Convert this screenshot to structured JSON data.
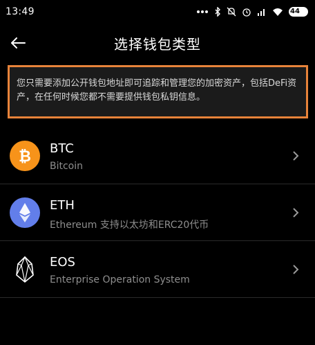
{
  "status_bar": {
    "time": "13:49",
    "battery": "44",
    "icons": [
      "dots-icon",
      "bluetooth-icon",
      "mute-icon",
      "alarm-icon",
      "signal-icon",
      "wifi-icon",
      "battery-icon"
    ]
  },
  "header": {
    "title": "选择钱包类型",
    "back_icon": "arrow-left-icon"
  },
  "notice": {
    "text": "您只需要添加公开钱包地址即可追踪和管理您的加密资产，包括DeFi资产，在任何时候您都不需要提供钱包私钥信息。",
    "highlight_color": "#e8833a"
  },
  "wallets": [
    {
      "symbol": "BTC",
      "name": "Bitcoin",
      "icon": "bitcoin-icon",
      "color": "#f7931a"
    },
    {
      "symbol": "ETH",
      "name": "Ethereum 支持以太坊和ERC20代币",
      "icon": "ethereum-icon",
      "color": "#627eea"
    },
    {
      "symbol": "EOS",
      "name": "Enterprise Operation System",
      "icon": "eos-icon",
      "color": "#ffffff"
    }
  ]
}
